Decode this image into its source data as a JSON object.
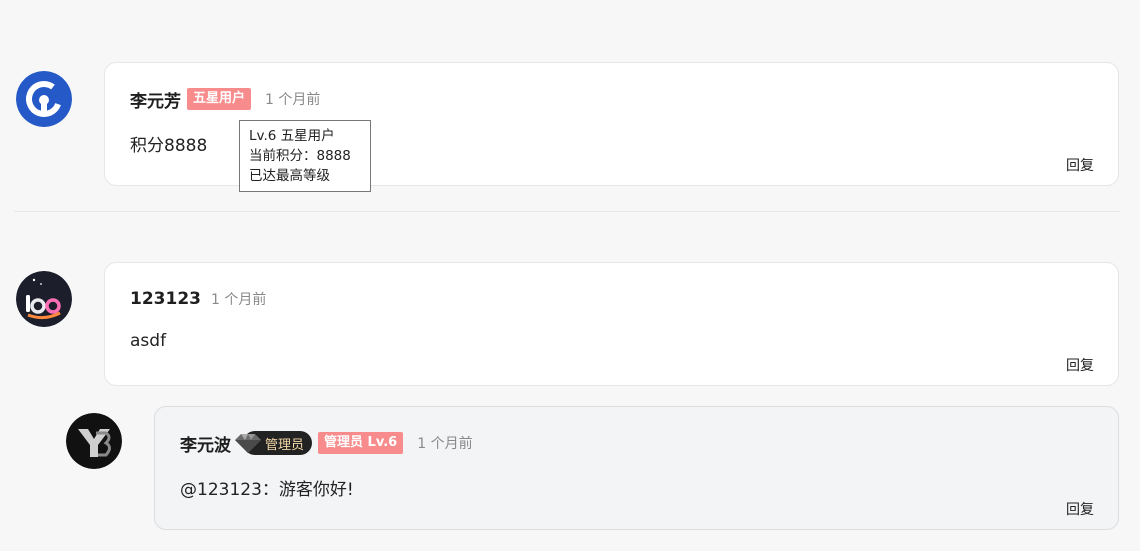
{
  "comments": [
    {
      "author": "李元芳",
      "badge": "五星用户",
      "time": "1 个月前",
      "content": "积分8888",
      "reply_label": "回复",
      "tooltip": {
        "line1": "Lv.6 五星用户",
        "line2": "当前积分：8888",
        "line3": "已达最高等级"
      }
    },
    {
      "author": "123123",
      "time": "1 个月前",
      "content": "asdf",
      "reply_label": "回复",
      "replies": [
        {
          "author": "李元波",
          "admin_tag": "管理员",
          "badge": "管理员 Lv.6",
          "time": "1 个月前",
          "content": "@123123：游客你好!",
          "reply_label": "回复"
        }
      ]
    }
  ],
  "colors": {
    "page_bg": "#f7f7f8",
    "badge_bg": "#f88b8b",
    "avatar1": "#2459c7",
    "avatar2": "#1c1f2b",
    "avatar3": "#111111"
  },
  "icons": {
    "avatar1": "user-avatar-c-logo",
    "avatar2": "user-avatar-bo-logo",
    "avatar3": "admin-avatar-yb-logo",
    "admin": "diamond-icon"
  }
}
